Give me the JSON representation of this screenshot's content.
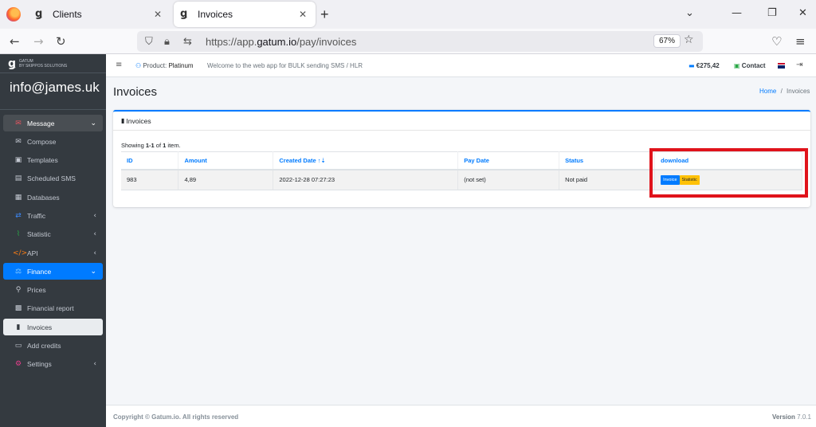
{
  "browser": {
    "tabs": [
      {
        "title": "Clients",
        "active": false
      },
      {
        "title": "Invoices",
        "active": true
      }
    ],
    "url_prefix": "https://app.",
    "url_domain": "gatum.io",
    "url_path": "/pay/invoices",
    "zoom": "67%"
  },
  "sidebar": {
    "brand": "GATUM",
    "brand_sub": "BY SKIPPOS SOLUTIONS",
    "user": "info@james.uk",
    "items": [
      {
        "label": "Message",
        "icon": "envelope-icon",
        "state": "open-grey",
        "arrow": "⌄"
      },
      {
        "label": "Compose",
        "icon": "compose-icon"
      },
      {
        "label": "Templates",
        "icon": "templates-icon"
      },
      {
        "label": "Scheduled SMS",
        "icon": "clock-icon"
      },
      {
        "label": "Databases",
        "icon": "database-icon"
      },
      {
        "label": "Traffic",
        "icon": "traffic-icon",
        "arrow": "‹"
      },
      {
        "label": "Statistic",
        "icon": "chart-icon",
        "arrow": "‹"
      },
      {
        "label": "API",
        "icon": "code-icon",
        "arrow": "‹"
      },
      {
        "label": "Finance",
        "icon": "finance-icon",
        "state": "open-blue",
        "arrow": "⌄"
      },
      {
        "label": "Prices",
        "icon": "search-icon"
      },
      {
        "label": "Financial report",
        "icon": "report-icon"
      },
      {
        "label": "Invoices",
        "icon": "file-icon",
        "state": "active"
      },
      {
        "label": "Add credits",
        "icon": "card-icon"
      },
      {
        "label": "Settings",
        "icon": "users-gear-icon",
        "arrow": "‹"
      }
    ]
  },
  "topnav": {
    "product_label": "Product:",
    "product_value": "Platinum",
    "welcome": "Welcome to the web app for BULK sending SMS / HLR",
    "balance": "€275,42",
    "contact": "Contact"
  },
  "page": {
    "title": "Invoices",
    "breadcrumb_home": "Home",
    "breadcrumb_sep": "/",
    "breadcrumb_current": "Invoices"
  },
  "card": {
    "title": "Invoices",
    "summary_prefix": "Showing ",
    "summary_range": "1-1",
    "summary_of": " of ",
    "summary_total": "1",
    "summary_suffix": " item."
  },
  "table": {
    "headers": [
      "ID",
      "Amount",
      "Created Date ↑⇣",
      "Pay Date",
      "Status",
      "download"
    ],
    "rows": [
      {
        "id": "983",
        "amount": "4,89",
        "created": "2022-12-28 07:27:23",
        "pay_date": "(not set)",
        "status": "Not paid",
        "invoice_btn": "Invoice",
        "statistic_btn": "Statistic"
      }
    ]
  },
  "footer": {
    "copyright": "Copyright © Gatum.io. All rights reserved",
    "version_label": "Version",
    "version": "7.0.1"
  },
  "colors": {
    "primary": "#007bff",
    "sidebar": "#343a40",
    "warning": "#ffc107",
    "highlight": "#e0131b"
  }
}
